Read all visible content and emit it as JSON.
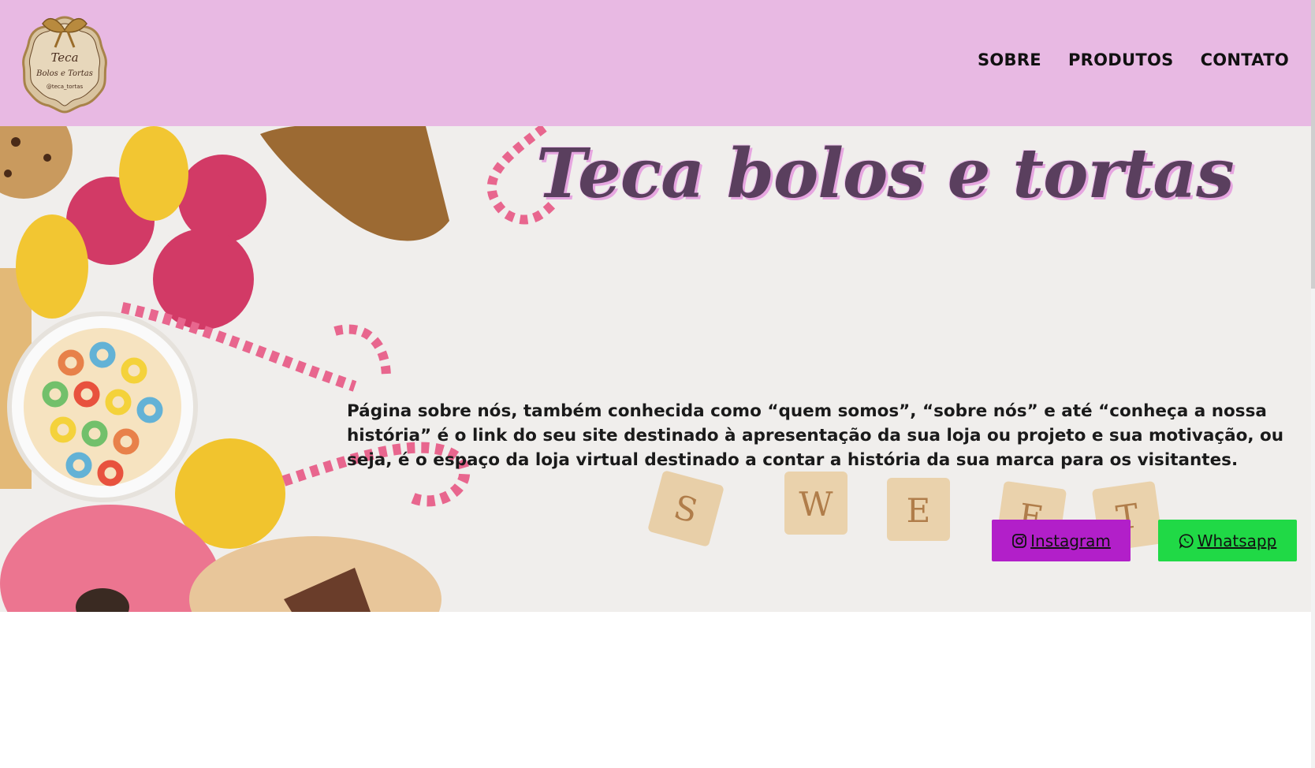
{
  "header": {
    "logo_lines": [
      "Teca",
      "Bolos e Tortas",
      "@teca_tortas"
    ],
    "nav": [
      {
        "label": "SOBRE"
      },
      {
        "label": "PRODUTOS"
      },
      {
        "label": "CONTATO"
      }
    ]
  },
  "hero": {
    "title": "Teca bolos e tortas",
    "about_text": "Página sobre nós, também conhecida como “quem somos”, “sobre nós” e até “conheça a nossa história” é o link do seu site destinado à apresentação da sua loja ou projeto e sua motivação, ou seja, é o espaço da loja virtual destinado a contar a história da sua marca para os visitantes.",
    "tiles": [
      "S",
      "W",
      "E",
      "E",
      "T"
    ],
    "buttons": {
      "instagram": "Instagram",
      "whatsapp": "Whatsapp"
    }
  },
  "colors": {
    "header_bg": "#e8b9e3",
    "title": "#5a3f5e",
    "instagram_button": "#b21fc9",
    "whatsapp_button": "#20d946"
  }
}
